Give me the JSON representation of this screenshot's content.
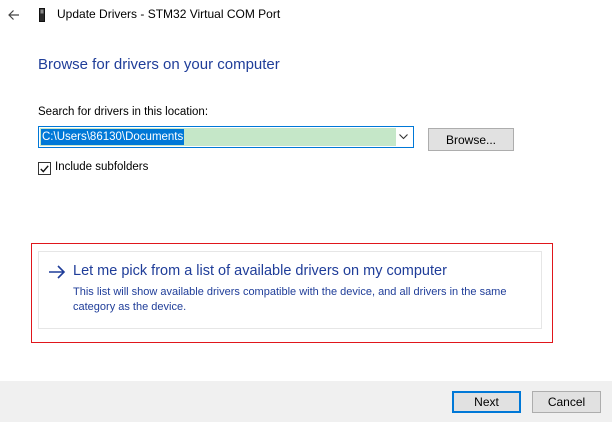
{
  "window": {
    "title": "Update Drivers - STM32 Virtual COM Port"
  },
  "icons": {
    "back": "back-arrow-icon",
    "device": "usb-device-icon",
    "dropdown": "chevron-down-icon",
    "checkmark": "checkmark-icon",
    "option_arrow": "right-arrow-icon"
  },
  "main": {
    "heading": "Browse for drivers on your computer",
    "search_label": "Search for drivers in this location:",
    "path_value": "C:\\Users\\86130\\Documents",
    "browse_label": "Browse...",
    "include_subfolders": {
      "label": "Include subfolders",
      "checked": true
    }
  },
  "pick_option": {
    "title": "Let me pick from a list of available drivers on my computer",
    "description": "This list will show available drivers compatible with the device, and all drivers in the same category as the device."
  },
  "footer": {
    "next_label": "Next",
    "cancel_label": "Cancel"
  },
  "colors": {
    "heading_blue": "#1f3d99",
    "selection_blue": "#0078d7",
    "highlight_red": "#e0161b",
    "footer_bg": "#f0f0f0"
  }
}
